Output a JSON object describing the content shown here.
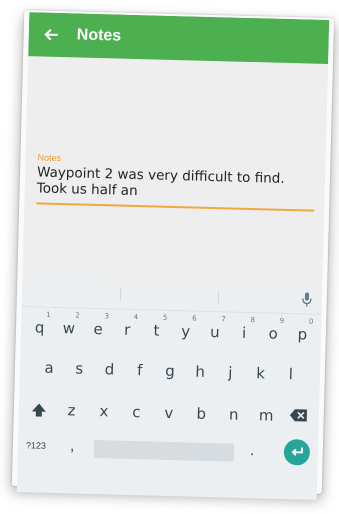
{
  "appbar": {
    "title": "Notes",
    "back_icon": "arrow-back-icon",
    "color": "#4caf50"
  },
  "notes_field": {
    "label": "Notes",
    "value_line1": "Waypoint 2 was very difficult to find.",
    "value_line2": "Took us half an",
    "accent_color": "#f29b21"
  },
  "keyboard": {
    "row1": [
      {
        "key": "q",
        "num": "1"
      },
      {
        "key": "w",
        "num": "2"
      },
      {
        "key": "e",
        "num": "3"
      },
      {
        "key": "r",
        "num": "4"
      },
      {
        "key": "t",
        "num": "5"
      },
      {
        "key": "y",
        "num": "6"
      },
      {
        "key": "u",
        "num": "7"
      },
      {
        "key": "i",
        "num": "8"
      },
      {
        "key": "o",
        "num": "9"
      },
      {
        "key": "p",
        "num": "0"
      }
    ],
    "row2": [
      "a",
      "s",
      "d",
      "f",
      "g",
      "h",
      "j",
      "k",
      "l"
    ],
    "row3": [
      "z",
      "x",
      "c",
      "v",
      "b",
      "n",
      "m"
    ],
    "symbols_key": "?123",
    "comma": ",",
    "period": ".",
    "mic_icon": "microphone-icon",
    "shift_icon": "shift-icon",
    "backspace_icon": "backspace-icon",
    "enter_icon": "enter-icon",
    "enter_color": "#26a69a"
  }
}
